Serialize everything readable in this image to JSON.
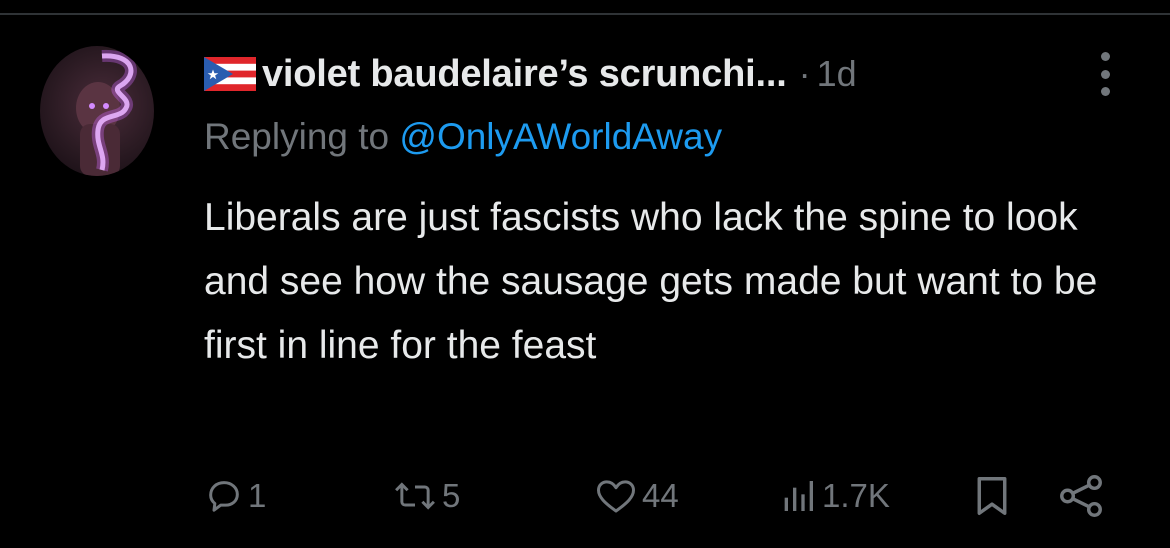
{
  "tweet": {
    "author": {
      "display_name": "violet baudelaire’s scrunchi...",
      "flag": "puerto-rico-flag"
    },
    "separator": "·",
    "timestamp": "1d",
    "replying_prefix": "Replying to ",
    "replying_handle": "@OnlyAWorldAway",
    "text": "Liberals are just fascists who lack the spine to look and see how the sausage gets made but want to be first in line for the feast"
  },
  "actions": {
    "reply": {
      "icon": "reply-icon",
      "count": "1"
    },
    "retweet": {
      "icon": "retweet-icon",
      "count": "5"
    },
    "like": {
      "icon": "heart-icon",
      "count": "44"
    },
    "views": {
      "icon": "views-icon",
      "count": "1.7K"
    },
    "bookmark": {
      "icon": "bookmark-icon"
    },
    "share": {
      "icon": "share-icon"
    }
  },
  "colors": {
    "background": "#000000",
    "primary_text": "#e7e9ea",
    "secondary_text": "#71767b",
    "link": "#1d9bf0"
  }
}
